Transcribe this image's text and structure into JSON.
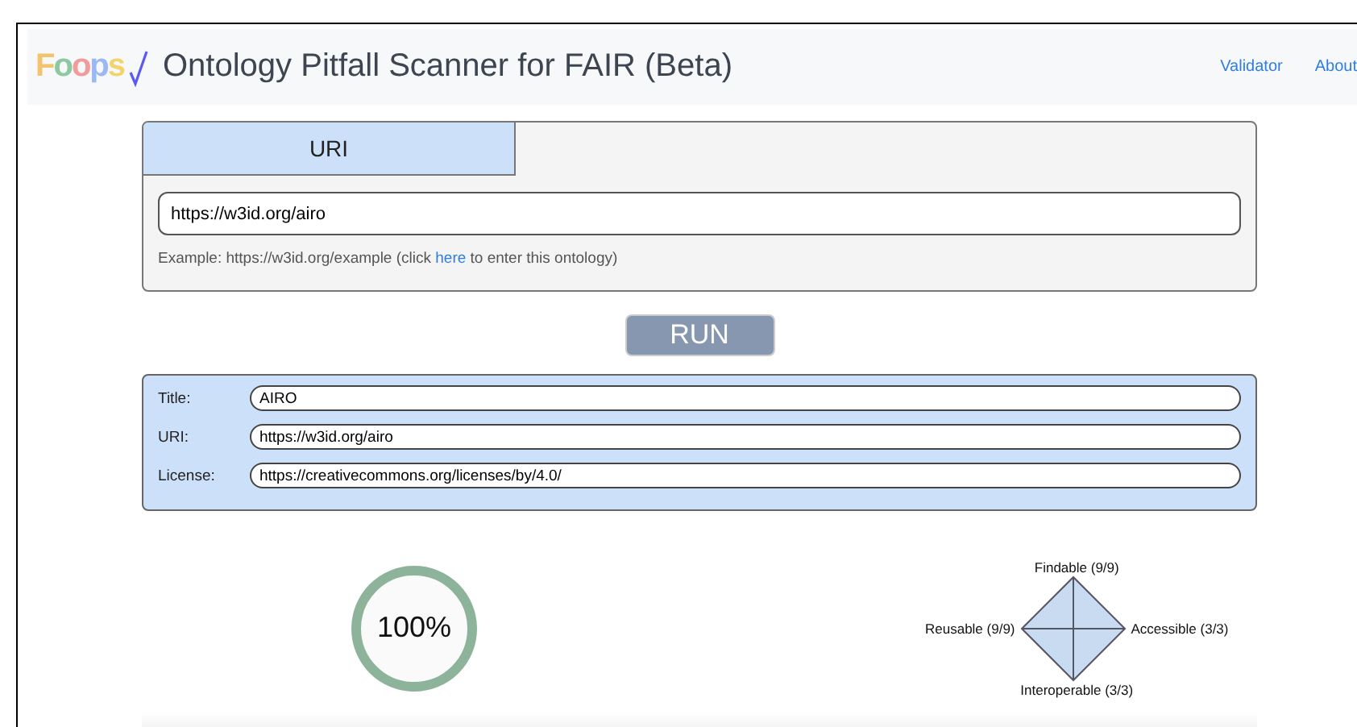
{
  "navbar": {
    "logo": "Foops",
    "title": "Ontology Pitfall Scanner for FAIR (Beta)",
    "links": [
      "Validator",
      "About"
    ]
  },
  "input_card": {
    "tabs": [
      {
        "label": "URI",
        "selected": true
      }
    ],
    "uri_field": {
      "value": "https://w3id.org/airo"
    },
    "example_before": "Example: https://w3id.org/example (click ",
    "example_link": "here",
    "example_after": " to enter this ontology)"
  },
  "run_button": "RUN",
  "metadata": [
    {
      "label": "Title:",
      "value": "AIRO"
    },
    {
      "label": "URI:",
      "value": "https://w3id.org/airo"
    },
    {
      "label": "License:",
      "value": "https://creativecommons.org/licenses/by/4.0/"
    }
  ],
  "score": {
    "text": "100%"
  },
  "fair": {
    "top": "Findable (9/9)",
    "right": "Accessible (3/3)",
    "bottom": "Interoperable (3/3)",
    "left": "Reusable (9/9)"
  }
}
